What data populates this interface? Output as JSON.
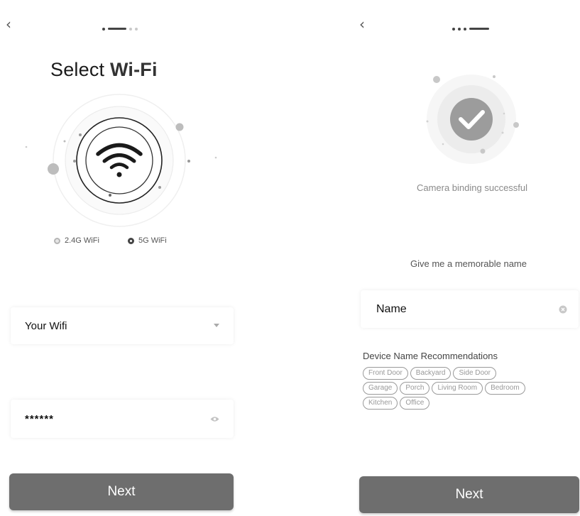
{
  "left": {
    "back_glyph": "‹",
    "title_prefix": "Select",
    "title_wifi": "Wi-Fi",
    "band_24": "2.4G WiFi",
    "band_5": "5G WiFi",
    "ssid_value": "Your Wifi",
    "password_value": "******",
    "next_label": "Next"
  },
  "right": {
    "back_glyph": "‹",
    "success_text": "Camera binding successful",
    "name_prompt": "Give me a memorable name",
    "name_value": "Name",
    "recommend_title": "Device Name Recommendations",
    "chips": [
      "Front Door",
      "Backyard",
      "Side Door",
      "Garage",
      "Porch",
      "Living Room",
      "Bedroom",
      "Kitchen",
      "Office"
    ],
    "next_label": "Next"
  },
  "colors": {
    "button": "#6e6e6e",
    "check_circle": "#9c9c9c",
    "text_muted": "#777777"
  }
}
